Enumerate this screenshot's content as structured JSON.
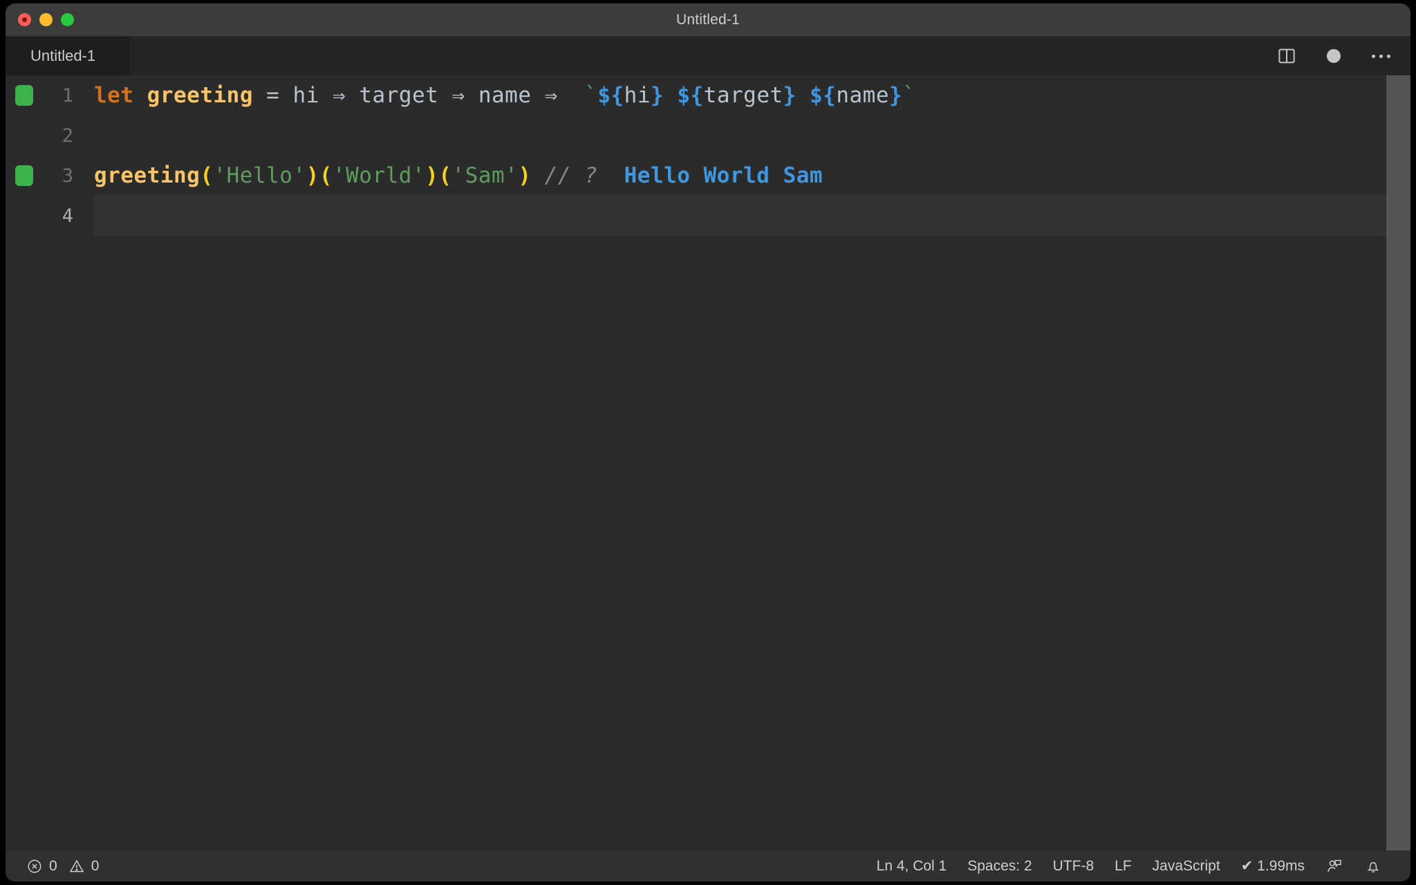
{
  "window": {
    "title": "Untitled-1",
    "traffic_lights": [
      "close",
      "minimize",
      "maximize"
    ]
  },
  "tab": {
    "label": "Untitled-1",
    "dirty": true
  },
  "editor_actions": [
    {
      "name": "split-editor-icon",
      "label": "Split Editor"
    },
    {
      "name": "unsaved-dot-icon",
      "label": "Unsaved changes"
    },
    {
      "name": "more-actions-icon",
      "label": "More Actions..."
    }
  ],
  "editor": {
    "language": "JavaScript",
    "current_line": 4,
    "lines": [
      {
        "number": "1",
        "gutter": "ok",
        "current": false,
        "tokens": [
          {
            "t": "let",
            "c": "t-keyword"
          },
          {
            "t": " ",
            "c": "t-plain"
          },
          {
            "t": "greeting",
            "c": "t-func"
          },
          {
            "t": " ",
            "c": "t-plain"
          },
          {
            "t": "=",
            "c": "t-op"
          },
          {
            "t": " ",
            "c": "t-plain"
          },
          {
            "t": "hi",
            "c": "t-var"
          },
          {
            "t": " ",
            "c": "t-plain"
          },
          {
            "t": "⇒",
            "c": "t-arrow"
          },
          {
            "t": " ",
            "c": "t-plain"
          },
          {
            "t": "target",
            "c": "t-var"
          },
          {
            "t": " ",
            "c": "t-plain"
          },
          {
            "t": "⇒",
            "c": "t-arrow"
          },
          {
            "t": " ",
            "c": "t-plain"
          },
          {
            "t": "name",
            "c": "t-var"
          },
          {
            "t": " ",
            "c": "t-plain"
          },
          {
            "t": "⇒",
            "c": "t-arrow"
          },
          {
            "t": "  ",
            "c": "t-plain"
          },
          {
            "t": "`",
            "c": "t-backtick"
          },
          {
            "t": "${",
            "c": "t-tpl-punct"
          },
          {
            "t": "hi",
            "c": "t-tpl-id"
          },
          {
            "t": "}",
            "c": "t-tpl-punct"
          },
          {
            "t": " ",
            "c": "t-backtick"
          },
          {
            "t": "${",
            "c": "t-tpl-punct"
          },
          {
            "t": "target",
            "c": "t-tpl-id"
          },
          {
            "t": "}",
            "c": "t-tpl-punct"
          },
          {
            "t": " ",
            "c": "t-backtick"
          },
          {
            "t": "${",
            "c": "t-tpl-punct"
          },
          {
            "t": "name",
            "c": "t-tpl-id"
          },
          {
            "t": "}",
            "c": "t-tpl-punct"
          },
          {
            "t": "`",
            "c": "t-backtick"
          }
        ],
        "text": "let greeting = hi => target => name => `${hi} ${target} ${name}`"
      },
      {
        "number": "2",
        "gutter": "none",
        "current": false,
        "tokens": [],
        "text": ""
      },
      {
        "number": "3",
        "gutter": "ok",
        "current": false,
        "tokens": [
          {
            "t": "greeting",
            "c": "t-funcall"
          },
          {
            "t": "(",
            "c": "t-paren"
          },
          {
            "t": "'Hello'",
            "c": "t-string"
          },
          {
            "t": ")",
            "c": "t-paren"
          },
          {
            "t": "(",
            "c": "t-paren"
          },
          {
            "t": "'World'",
            "c": "t-string"
          },
          {
            "t": ")",
            "c": "t-paren"
          },
          {
            "t": "(",
            "c": "t-paren"
          },
          {
            "t": "'Sam'",
            "c": "t-string"
          },
          {
            "t": ")",
            "c": "t-paren"
          },
          {
            "t": " ",
            "c": "t-plain"
          },
          {
            "t": "// ?",
            "c": "t-comment"
          },
          {
            "t": "  ",
            "c": "t-plain"
          },
          {
            "t": "Hello World Sam",
            "c": "t-result"
          }
        ],
        "text": "greeting('Hello')('World')('Sam') // ?  Hello World Sam",
        "inline_result": "Hello World Sam"
      },
      {
        "number": "4",
        "gutter": "none",
        "current": true,
        "tokens": [],
        "text": ""
      }
    ]
  },
  "statusbar": {
    "left": [
      {
        "name": "error-count",
        "icon": "error-circle-icon",
        "value": "0"
      },
      {
        "name": "warning-count",
        "icon": "warning-triangle-icon",
        "value": "0"
      }
    ],
    "right": [
      {
        "name": "cursor-position",
        "value": "Ln 4, Col 1"
      },
      {
        "name": "indentation",
        "value": "Spaces: 2"
      },
      {
        "name": "encoding",
        "value": "UTF-8"
      },
      {
        "name": "eol",
        "value": "LF"
      },
      {
        "name": "language-mode",
        "value": "JavaScript"
      },
      {
        "name": "quokka-time",
        "value": "✔ 1.99ms"
      }
    ],
    "icons": [
      {
        "name": "live-share-icon",
        "label": "Live Share"
      },
      {
        "name": "bell-icon",
        "label": "Notifications"
      }
    ]
  },
  "colors": {
    "window_chrome": "#3c3c3c",
    "tabbar": "#252526",
    "editor_bg": "#2b2b2b",
    "current_line_bg": "#323232",
    "statusbar_bg": "#303030",
    "gutter_ok": "#3eb24a",
    "keyword": "#d2721d",
    "function": "#fcc369",
    "string": "#5d9e5d",
    "paren": "#f2d024",
    "template_punct": "#3f97e0",
    "comment": "#888888",
    "result": "#3f97e0"
  }
}
